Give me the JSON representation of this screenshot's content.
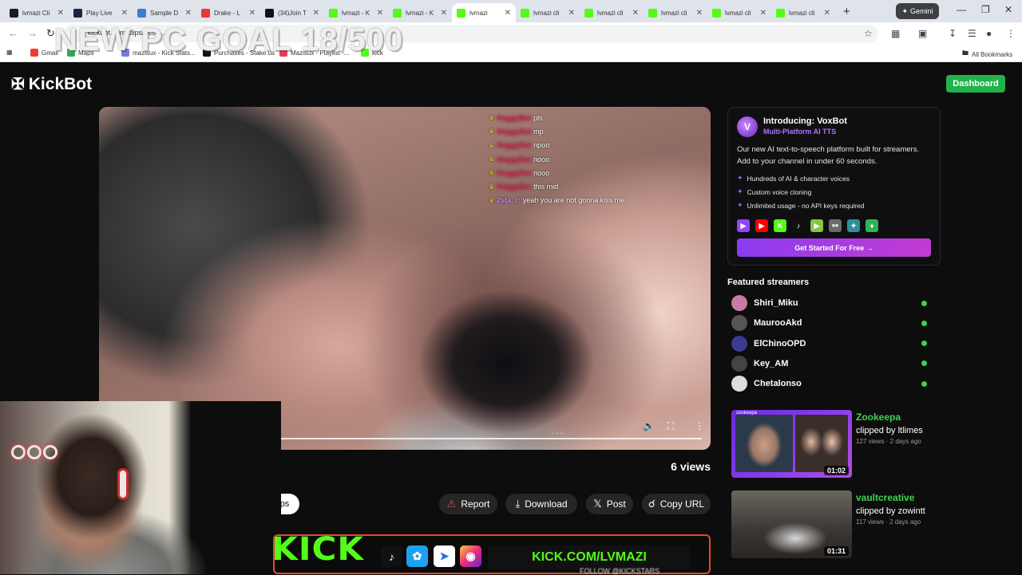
{
  "browser": {
    "tabs": [
      {
        "label": "lvmazi Cli",
        "color": "#1a1a1a"
      },
      {
        "label": "Play Live",
        "color": "#1d2440"
      },
      {
        "label": "Sample D",
        "color": "#3b7bd4"
      },
      {
        "label": "Drake - L",
        "color": "#e53935"
      },
      {
        "label": "(34)Join T",
        "color": "#111111"
      },
      {
        "label": "lvmazi - K",
        "color": "#53fc18"
      },
      {
        "label": "lvmazi - K",
        "color": "#53fc18"
      },
      {
        "label": "lvmazi",
        "color": "#53fc18"
      },
      {
        "label": "lvmazi cli",
        "color": "#53fc18"
      },
      {
        "label": "lvmazi cli",
        "color": "#53fc18"
      },
      {
        "label": "lvmazi cli",
        "color": "#53fc18"
      },
      {
        "label": "lvmazi cli",
        "color": "#53fc18"
      },
      {
        "label": "lvmazi cli",
        "color": "#53fc18"
      }
    ],
    "new_tab": "+",
    "gemini_label": "Gemini",
    "url": "kickbot.com/clips/3c55...",
    "bookmarks": [
      {
        "label": "Gmail",
        "color": "#e94235"
      },
      {
        "label": "Maps",
        "color": "#34a853"
      },
      {
        "label": "mazisux - Kick Stats...",
        "color": "#7a7ad9"
      },
      {
        "label": "Purchases - Stake.us",
        "color": "#111111"
      },
      {
        "label": "Mazisux - Playlist -...",
        "color": "#e53e5c"
      },
      {
        "label": "kick",
        "color": "#53fc18"
      }
    ],
    "all_bookmarks": "All Bookmarks"
  },
  "stream_overlay": {
    "goal_text": "NEW PC GOAL 18/500",
    "kick_text": "KICK",
    "kick_url": "KICK.COM/LVMAZI",
    "follow_text": "FOLLOW @KICKSTARS"
  },
  "header": {
    "logo_text": "KickBot",
    "dashboard_label": "Dashboard"
  },
  "video": {
    "chat": [
      {
        "user": "NoggyBot",
        "message": "pls",
        "user_style": "blur"
      },
      {
        "user": "NoggyBot",
        "message": "mp",
        "user_style": "blur"
      },
      {
        "user": "NoggyBot",
        "message": "npoo",
        "user_style": "blur"
      },
      {
        "user": "NoggyBot",
        "message": "nooo",
        "user_style": "blur"
      },
      {
        "user": "NoggyBot",
        "message": "nooo",
        "user_style": "blur"
      },
      {
        "user": "NoggyBot",
        "message": "this mid",
        "user_style": "blur"
      },
      {
        "user": "2sta_r:",
        "message": "yeah you are not gonna kiss me",
        "user_style": "plain"
      }
    ],
    "progress": 1.0
  },
  "views_label": "6 views",
  "clips_label": "ps",
  "actions": {
    "report": "Report",
    "download": "Download",
    "post": "Post",
    "copy_url": "Copy URL"
  },
  "voxbot": {
    "title": "Introducing: VoxBot",
    "subtitle": "Multi-Platform AI TTS",
    "description": "Our new AI text-to-speech platform built for streamers. Add to your channel in under 60 seconds.",
    "bullets": [
      "Hundreds of AI & character voices",
      "Custom voice cloning",
      "Unlimited usage - no API keys required"
    ],
    "cta": "Get Started For Free →",
    "platforms": [
      {
        "icon": "twitch-icon",
        "color": "#9146ff"
      },
      {
        "icon": "youtube-icon",
        "color": "#ff0000"
      },
      {
        "icon": "kick-icon",
        "color": "#53fc18"
      },
      {
        "icon": "tiktok-icon",
        "color": "#111111"
      },
      {
        "icon": "rumble-icon",
        "color": "#85c742"
      },
      {
        "icon": "link-icon",
        "color": "#6b6b6b"
      },
      {
        "icon": "sparkle-icon",
        "color": "#2f8f9d"
      },
      {
        "icon": "puzzle-icon",
        "color": "#2fb35a"
      }
    ]
  },
  "featured": {
    "heading": "Featured streamers",
    "streamers": [
      {
        "name": "Shiri_Miku",
        "avatar_color": "#c77aa8",
        "live": true
      },
      {
        "name": "MaurooAkd",
        "avatar_color": "#555555",
        "live": true
      },
      {
        "name": "ElChinoOPD",
        "avatar_color": "#3b3b8f",
        "live": true
      },
      {
        "name": "Key_AM",
        "avatar_color": "#444444",
        "live": true
      },
      {
        "name": "Chetalonso",
        "avatar_color": "#dddddd",
        "live": true
      }
    ]
  },
  "clips": [
    {
      "channel": "Zookeepa",
      "clipped_by": "clipped by ltlimes",
      "meta": "127 views · 2 days ago",
      "duration": "01:02",
      "tag": "zookeepa"
    },
    {
      "channel": "vaultcreative",
      "clipped_by": "clipped by zowintt",
      "meta": "117 views · 2 days ago",
      "duration": "01:31",
      "tag": ""
    }
  ],
  "colors": {
    "accent_green": "#3cd44e",
    "kick_green": "#53fc18",
    "vox_purple": "#a35cff",
    "report_red": "#e84545"
  }
}
